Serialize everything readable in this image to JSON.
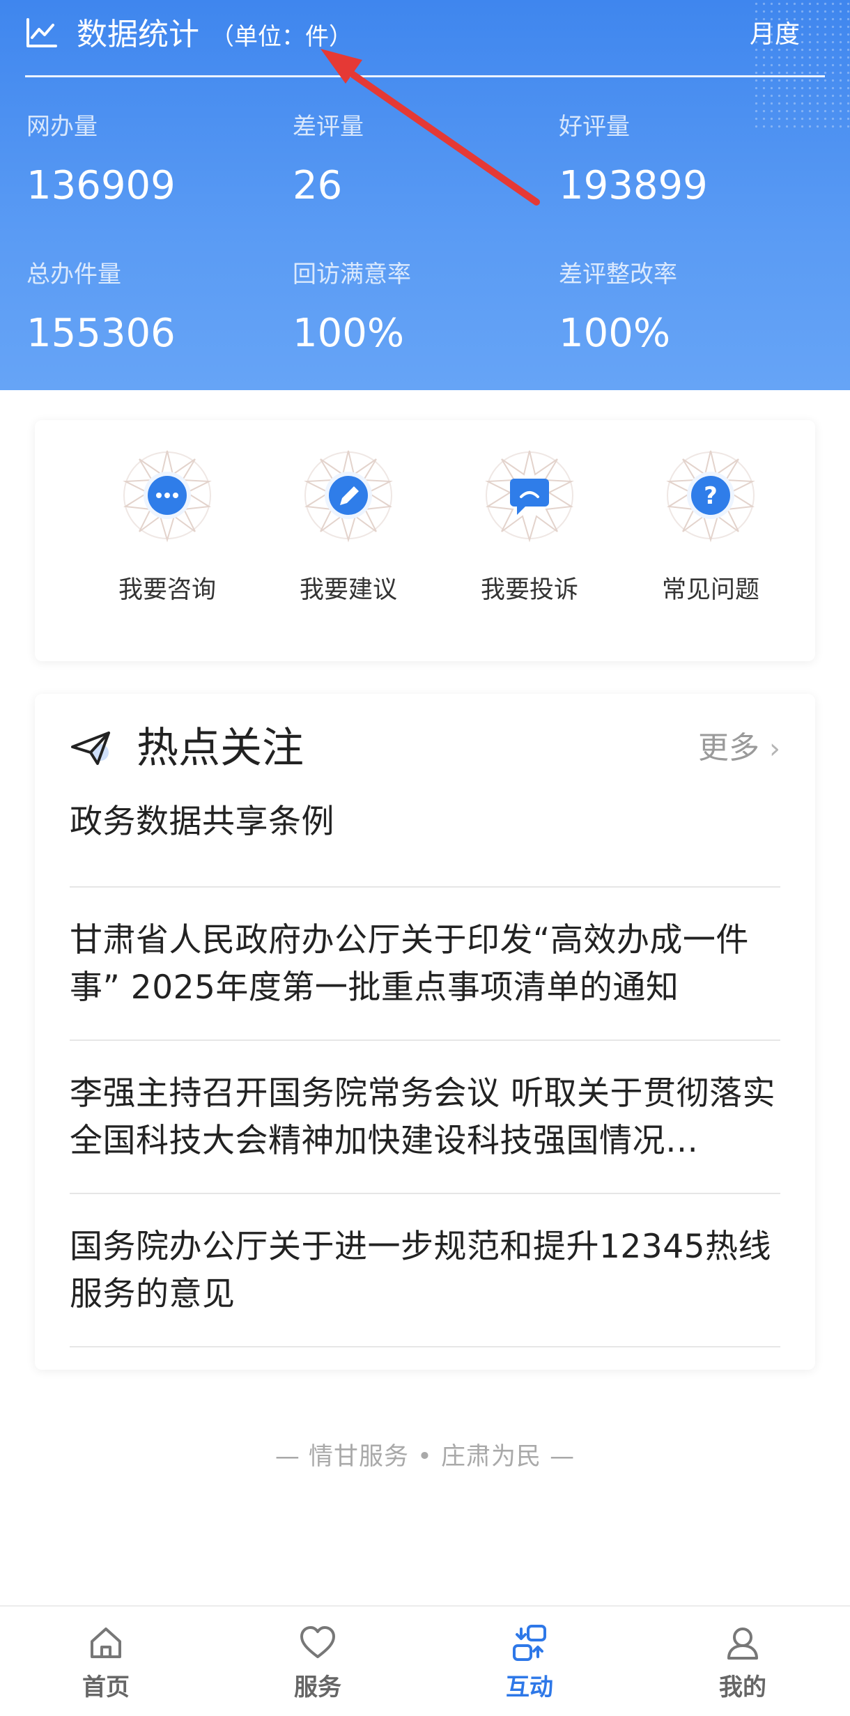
{
  "stats": {
    "title": "数据统计",
    "unit": "（单位：件）",
    "period": "月度",
    "metrics": [
      {
        "label": "网办量",
        "value": "136909"
      },
      {
        "label": "差评量",
        "value": "26"
      },
      {
        "label": "好评量",
        "value": "193899"
      },
      {
        "label": "总办件量",
        "value": "155306"
      },
      {
        "label": "回访满意率",
        "value": "100%"
      },
      {
        "label": "差评整改率",
        "value": "100%"
      }
    ]
  },
  "actions": [
    {
      "label": "我要咨询",
      "icon": "chat-bubble-icon"
    },
    {
      "label": "我要建议",
      "icon": "pencil-icon"
    },
    {
      "label": "我要投诉",
      "icon": "complaint-icon"
    },
    {
      "label": "常见问题",
      "icon": "question-icon"
    }
  ],
  "hot": {
    "title": "热点关注",
    "more": "更多",
    "items": [
      "政务数据共享条例",
      "甘肃省人民政府办公厅关于印发“高效办成一件事” 2025年度第一批重点事项清单的通知",
      "李强主持召开国务院常务会议 听取关于贯彻落实全国科技大会精神加快建设科技强国情况…",
      "国务院办公厅关于进一步规范和提升12345热线服务的意见"
    ]
  },
  "slogan": "— 情甘服务 • 庄肃为民 —",
  "tabbar": [
    {
      "label": "首页",
      "active": false
    },
    {
      "label": "服务",
      "active": false
    },
    {
      "label": "互动",
      "active": true
    },
    {
      "label": "我的",
      "active": false
    }
  ],
  "colors": {
    "header_blue": "#4a8ff0",
    "accent": "#2e78e8",
    "annotation_arrow": "#e53935"
  }
}
